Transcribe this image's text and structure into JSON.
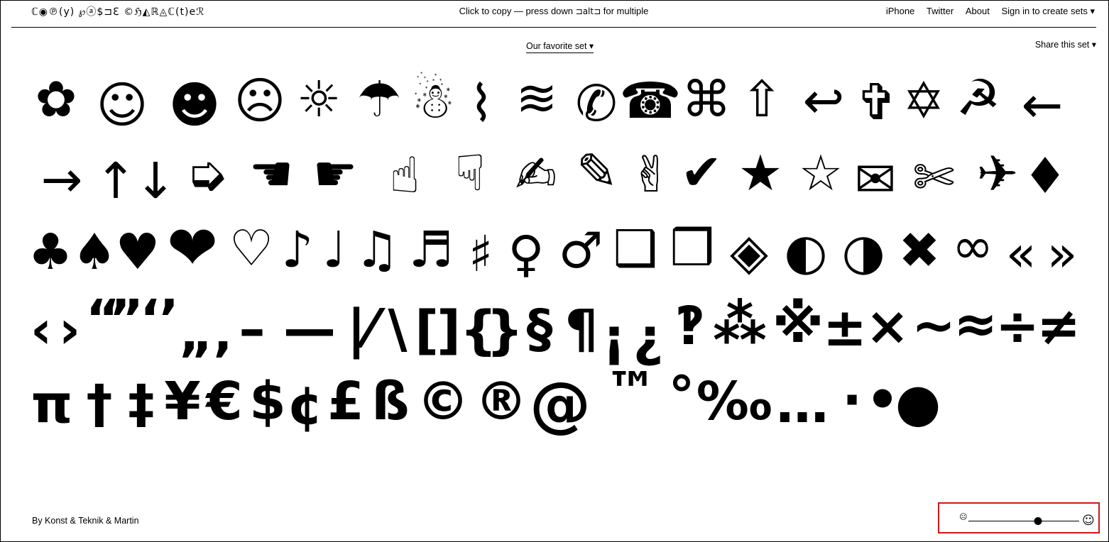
{
  "header": {
    "logo": "ℂ◉℗(y) ℘ⓐ$⊐ℇ ©ℌ◭ℝ◬ℂ(t)eℛ",
    "tagline_pre": "Click to copy — press down ",
    "tagline_key": "⊐alt⊐",
    "tagline_post": " for multiple",
    "nav": {
      "iphone": "iPhone",
      "twitter": "Twitter",
      "about": "About",
      "sign_in": "Sign in to create sets ▾"
    }
  },
  "set_selector": {
    "label": "Our favorite set ▾"
  },
  "share": {
    "label": "Share this set ▾"
  },
  "characters": {
    "row1": [
      "✿",
      "☺",
      "☻",
      "☹",
      "☼",
      "☂",
      "☃",
      "⌇",
      "≋",
      "✆",
      "☎",
      "⌘",
      "⇧",
      "↩",
      "✞",
      "✡",
      "☭",
      "←"
    ],
    "row2": [
      "→",
      "↑",
      "↓",
      "➭",
      "☚",
      "☛",
      "☝",
      "☟",
      "✍",
      "✎",
      "✌",
      "✔",
      "★",
      "☆",
      "✉",
      "✄",
      "✈",
      "♦"
    ],
    "row3": [
      "♣",
      "♠",
      "♥",
      "❤",
      "♡",
      "♪",
      "♩",
      "♫",
      "♬",
      "♯",
      "♀",
      "♂",
      "❑",
      "❒",
      "◈",
      "◐",
      "◑",
      "✖",
      "∞",
      "«",
      "»"
    ],
    "row4": [
      "‹",
      "›",
      "“",
      "”",
      "‘",
      "’",
      "„",
      "‚",
      "–",
      "—",
      "|",
      "⁄",
      "\\",
      "[",
      "]",
      "{",
      "}",
      "§",
      "¶",
      "¡",
      "¿",
      "‽",
      "⁂",
      "※",
      "±",
      "×",
      "~",
      "≈",
      "÷",
      "≠"
    ],
    "row5": [
      "π",
      "†",
      "‡",
      "¥",
      "€",
      "$",
      "¢",
      "£",
      "ß",
      "©",
      "®",
      "@",
      "™",
      "°",
      "‰",
      "…",
      "·",
      "•",
      "●"
    ]
  },
  "footer": {
    "credit": "By Konst & Teknik & Martin",
    "size_slider": {
      "min_icon": "☹",
      "max_icon": "☺",
      "value": 0.63
    }
  }
}
